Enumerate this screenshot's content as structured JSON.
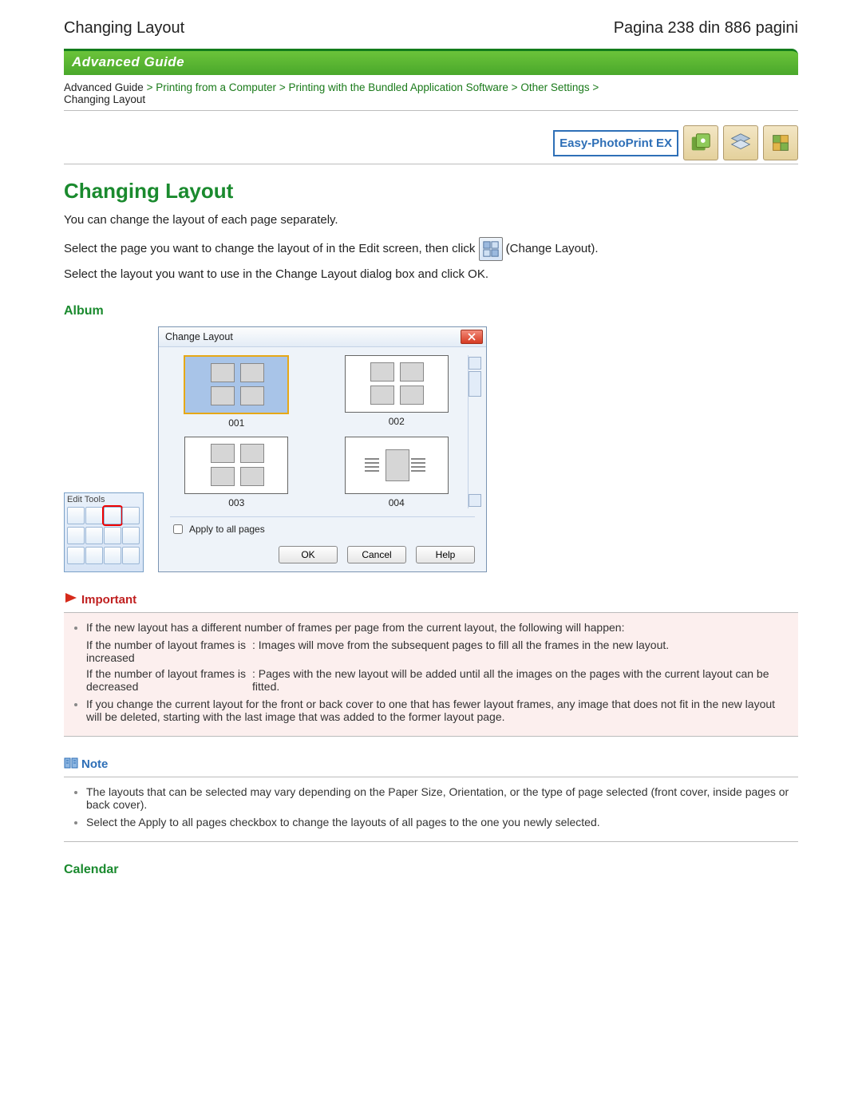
{
  "header": {
    "left": "Changing Layout",
    "right": "Pagina 238 din 886 pagini"
  },
  "banner": "Advanced Guide",
  "breadcrumb": {
    "items": [
      "Advanced Guide",
      "Printing from a Computer",
      "Printing with the Bundled Application Software",
      "Other Settings"
    ],
    "current": "Changing Layout",
    "sep": ">"
  },
  "app_label": "Easy-PhotoPrint EX",
  "page_title": "Changing Layout",
  "intro": "You can change the layout of each page separately.",
  "para1_a": "Select the page you want to change the layout of in the Edit screen, then click ",
  "para1_b": " (Change Layout).",
  "para2": "Select the layout you want to use in the Change Layout dialog box and click OK.",
  "sections": {
    "album": "Album",
    "calendar": "Calendar"
  },
  "edit_tools_title": "Edit Tools",
  "dialog": {
    "title": "Change Layout",
    "items": [
      "001",
      "002",
      "003",
      "004"
    ],
    "apply_label": "Apply to all pages",
    "buttons": {
      "ok": "OK",
      "cancel": "Cancel",
      "help": "Help"
    }
  },
  "important": {
    "title": "Important",
    "bullet1": "If the new layout has a different number of frames per page from the current layout, the following will happen:",
    "rows": [
      {
        "k": "If the number of layout frames is increased",
        "v": ": Images will move from the subsequent pages to fill all the frames in the new layout."
      },
      {
        "k": "If the number of layout frames is decreased",
        "v": ": Pages with the new layout will be added until all the images on the pages with the current layout can be fitted."
      }
    ],
    "bullet2": "If you change the current layout for the front or back cover to one that has fewer layout frames, any image that does not fit in the new layout will be deleted, starting with the last image that was added to the former layout page."
  },
  "note": {
    "title": "Note",
    "bullets": [
      "The layouts that can be selected may vary depending on the Paper Size, Orientation, or the type of page selected (front cover, inside pages or back cover).",
      "Select the Apply to all pages checkbox to change the layouts of all pages to the one you newly selected."
    ]
  }
}
